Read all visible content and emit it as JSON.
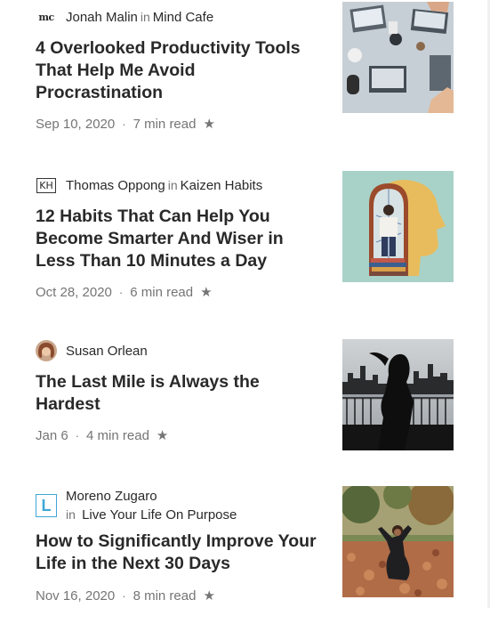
{
  "articles": [
    {
      "logo": "mc",
      "logo_icon": "mind-cafe-logo",
      "author": "Jonah Malin",
      "in_label": "in",
      "publication": "Mind Cafe",
      "title": "4 Overlooked Productivity Tools That Help Me Avoid Procrastination",
      "date": "Sep 10, 2020",
      "separator": "·",
      "read_time": "7 min read",
      "star": "★",
      "thumbnail": "desk-laptops-photo"
    },
    {
      "logo": "KH",
      "logo_icon": "kaizen-habits-logo",
      "author": "Thomas Oppong",
      "in_label": "in",
      "publication": "Kaizen Habits",
      "title": "12 Habits That Can Help You Become Smarter And Wiser in Less Than 10 Minutes a Day",
      "date": "Oct 28, 2020",
      "separator": "·",
      "read_time": "6 min read",
      "star": "★",
      "thumbnail": "head-doorway-illustration"
    },
    {
      "logo_icon": "author-avatar",
      "author": "Susan Orlean",
      "title": "The Last Mile is Always the Hardest",
      "date": "Jan 6",
      "separator": "·",
      "read_time": "4 min read",
      "star": "★",
      "thumbnail": "runner-silhouette-photo"
    },
    {
      "logo": "L",
      "logo_icon": "live-your-life-logo",
      "author": "Moreno Zugaro",
      "in_label": "in",
      "publication": "Live Your Life On Purpose",
      "title": "How to Significantly Improve Your Life in the Next 30 Days",
      "date": "Nov 16, 2020",
      "separator": "·",
      "read_time": "8 min read",
      "star": "★",
      "thumbnail": "autumn-leaves-photo"
    }
  ],
  "colors": {
    "text": "#292929",
    "muted": "#757575",
    "accent_blue": "#3fa7d6"
  }
}
